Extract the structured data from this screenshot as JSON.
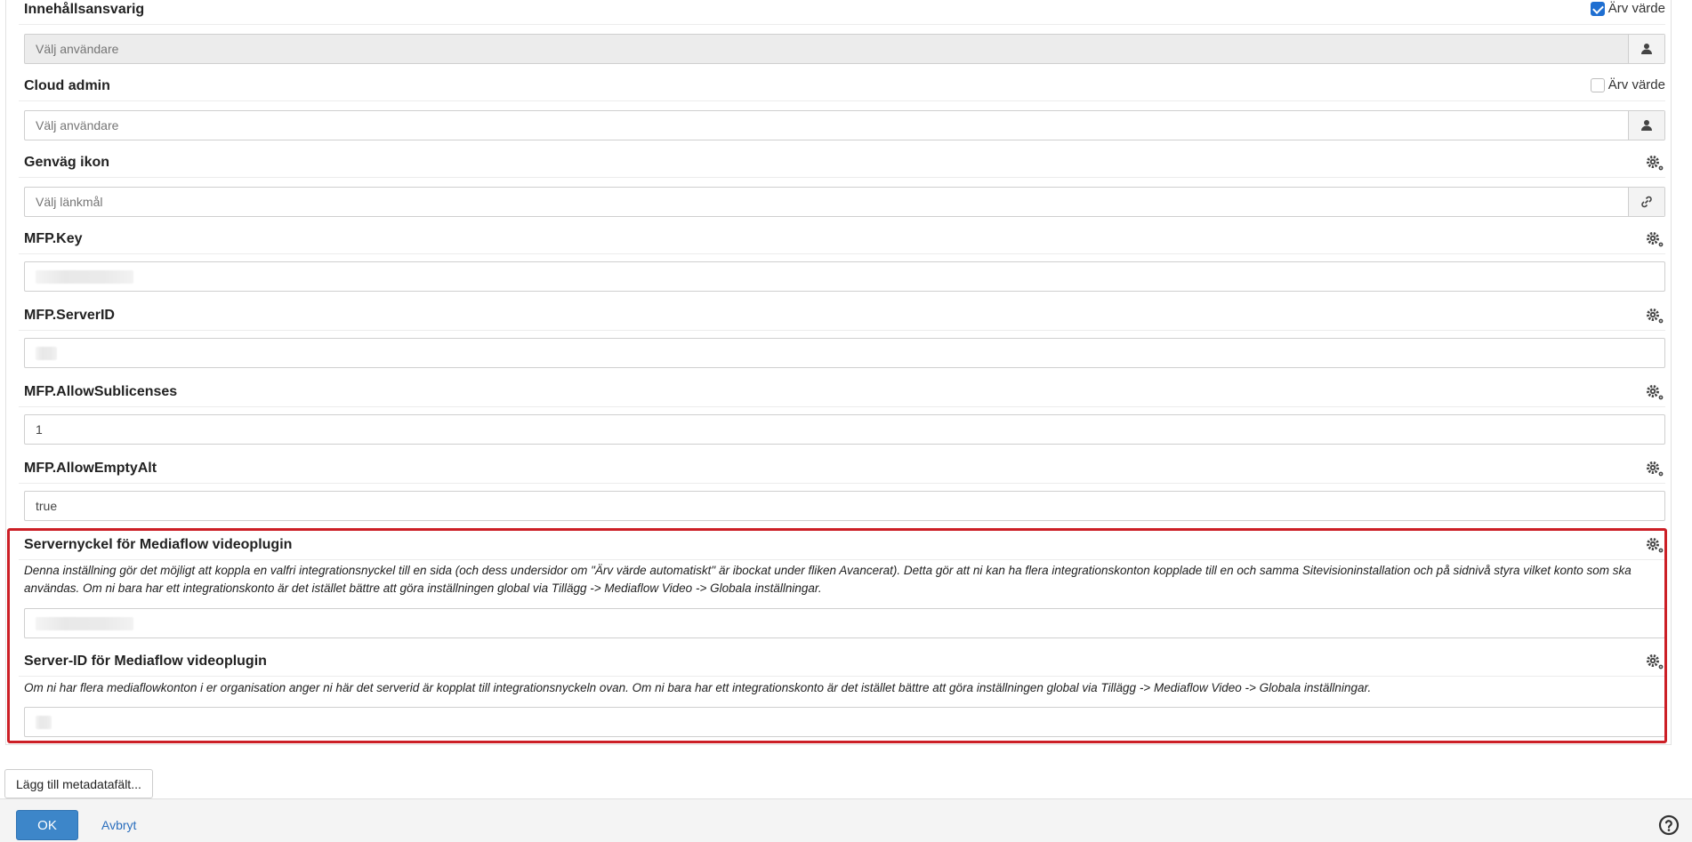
{
  "fields": {
    "content_owner": {
      "label": "Innehållsansvarig",
      "inherit_label": "Ärv värde",
      "inherit_checked": true,
      "placeholder": "Välj användare"
    },
    "cloud_admin": {
      "label": "Cloud admin",
      "inherit_label": "Ärv värde",
      "inherit_checked": false,
      "placeholder": "Välj användare"
    },
    "shortcut_icon": {
      "label": "Genväg ikon",
      "placeholder": "Välj länkmål"
    },
    "mfp_key": {
      "label": "MFP.Key",
      "value": ""
    },
    "mfp_serverid": {
      "label": "MFP.ServerID",
      "value": ""
    },
    "mfp_allowsublicenses": {
      "label": "MFP.AllowSublicenses",
      "value": "1"
    },
    "mfp_allowemptyalt": {
      "label": "MFP.AllowEmptyAlt",
      "value": "true"
    },
    "server_key": {
      "label": "Servernyckel för Mediaflow videoplugin",
      "description": "Denna inställning gör det möjligt att koppla en valfri integrationsnyckel till en sida (och dess undersidor om \"Ärv värde automatiskt\" är ibockat under fliken Avancerat). Detta gör att ni kan ha flera integrationskonton kopplade till en och samma Sitevisioninstallation och på sidnivå styra vilket konto som ska användas. Om ni bara har ett integrationskonto är det istället bättre att göra inställningen global via Tillägg -> Mediaflow Video -> Globala inställningar.",
      "value": ""
    },
    "server_id": {
      "label": "Server-ID för Mediaflow videoplugin",
      "description": "Om ni har flera mediaflowkonton i er organisation anger ni här det serverid är kopplat till integrationsnyckeln ovan. Om ni bara har ett integrationskonto är det istället bättre att göra inställningen global via Tillägg -> Mediaflow Video -> Globala inställningar.",
      "value": ""
    }
  },
  "buttons": {
    "add_metadata": "Lägg till metadatafält...",
    "ok": "OK",
    "cancel": "Avbryt"
  },
  "icons": {
    "user": "user-icon",
    "link": "link-icon",
    "settings": "gears-icon",
    "help": "help-circle-icon"
  },
  "colors": {
    "highlight_border": "#cc1f26",
    "ok_button": "#3d86c9",
    "checkbox_checked": "#1f6fd1"
  }
}
